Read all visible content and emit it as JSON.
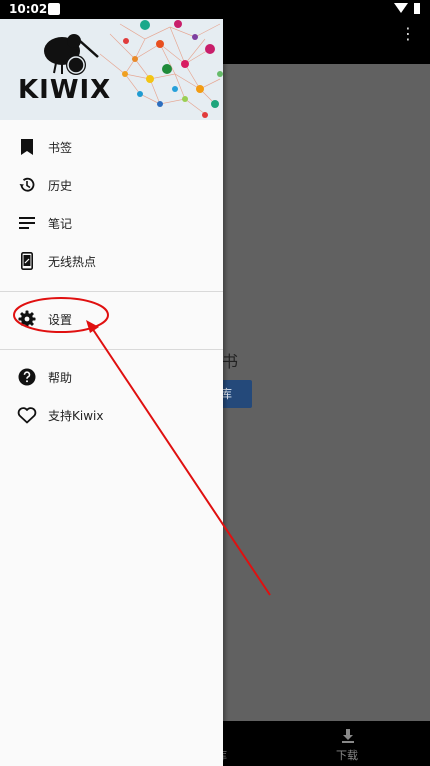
{
  "status_bar": {
    "time": "10:02"
  },
  "app_bar": {
    "overflow_menu": "⋮"
  },
  "background": {
    "empty_text": "开的书",
    "button_label": "库",
    "bottom_nav": {
      "library_label": "库",
      "download_label": "下载"
    }
  },
  "drawer": {
    "logo_text": "KIWIX",
    "items": [
      {
        "label": "书签",
        "icon": "bookmark-icon"
      },
      {
        "label": "历史",
        "icon": "history-icon"
      },
      {
        "label": "笔记",
        "icon": "notes-icon"
      },
      {
        "label": "无线热点",
        "icon": "hotspot-icon"
      },
      {
        "label": "设置",
        "icon": "gear-icon"
      },
      {
        "label": "帮助",
        "icon": "help-icon"
      },
      {
        "label": "支持Kiwix",
        "icon": "heart-icon"
      }
    ]
  },
  "colors": {
    "drawer_bg": "#fafafa",
    "annotation": "#e01010",
    "dim_bg": "#616161"
  }
}
